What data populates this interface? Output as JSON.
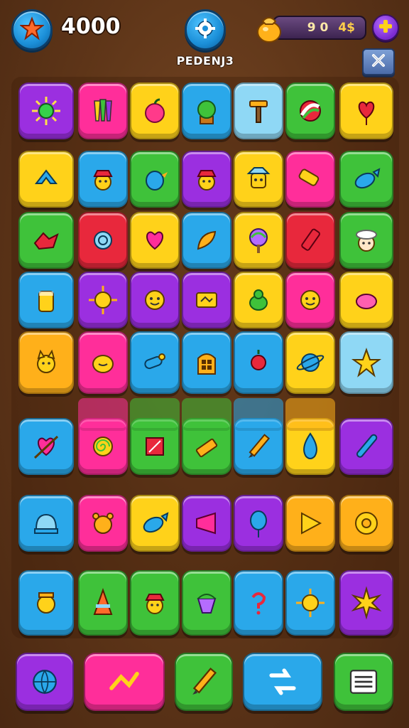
{
  "header": {
    "score": "4000",
    "level_label": "PEDENJ3",
    "currency_a": "9 0",
    "currency_b": "4$",
    "star_icon": "star-icon",
    "settings_icon": "gear-icon",
    "coin_icon": "coin-bag-icon",
    "plus_icon": "plus-icon",
    "close_icon": "close-icon"
  },
  "colors": {
    "purple": "#9b2fe0",
    "pink": "#ff2e9a",
    "yellow": "#ffd21a",
    "blue": "#2aa8ea",
    "lightblue": "#8fd8f5",
    "green": "#3fc23a",
    "red": "#e8283c",
    "orange": "#ffb01a"
  },
  "board": {
    "rows": [
      [
        {
          "color": "purple",
          "icon": "sun-gem-icon"
        },
        {
          "color": "pink",
          "icon": "crayons-icon"
        },
        {
          "color": "yellow",
          "icon": "apple-icon"
        },
        {
          "color": "blue",
          "icon": "potted-plant-icon"
        },
        {
          "color": "lightblue",
          "icon": "hammer-icon"
        },
        {
          "color": "green",
          "icon": "leaf-ball-icon"
        },
        {
          "color": "yellow",
          "icon": "heart-balloon-icon"
        }
      ],
      [
        {
          "color": "yellow",
          "icon": "ribbon-icon"
        },
        {
          "color": "blue",
          "icon": "hat-face-icon"
        },
        {
          "color": "green",
          "icon": "bird-icon"
        },
        {
          "color": "purple",
          "icon": "hat-face-icon"
        },
        {
          "color": "yellow",
          "icon": "robot-icon"
        },
        {
          "color": "pink",
          "icon": "roller-icon"
        },
        {
          "color": "green",
          "icon": "fish-icon"
        }
      ],
      [
        {
          "color": "green",
          "icon": "dragon-icon"
        },
        {
          "color": "red",
          "icon": "snail-icon"
        },
        {
          "color": "yellow",
          "icon": "heart-book-icon"
        },
        {
          "color": "blue",
          "icon": "feather-icon"
        },
        {
          "color": "yellow",
          "icon": "rainbow-tree-icon"
        },
        {
          "color": "red",
          "icon": "marker-icon"
        },
        {
          "color": "green",
          "icon": "cloud-face-icon"
        }
      ],
      [
        {
          "color": "blue",
          "icon": "jar-icon"
        },
        {
          "color": "purple",
          "icon": "sun-icon"
        },
        {
          "color": "purple",
          "icon": "smiley-icon"
        },
        {
          "color": "purple",
          "icon": "card-icon"
        },
        {
          "color": "yellow",
          "icon": "frog-icon"
        },
        {
          "color": "pink",
          "icon": "smiley-icon"
        },
        {
          "color": "yellow",
          "icon": "pig-icon"
        }
      ],
      [
        {
          "color": "orange",
          "icon": "cat-face-icon"
        },
        {
          "color": "pink",
          "icon": "blob-face-icon"
        },
        {
          "color": "blue",
          "icon": "cannon-icon"
        },
        {
          "color": "blue",
          "icon": "window-icon"
        },
        {
          "color": "blue",
          "icon": "flower-icon"
        },
        {
          "color": "yellow",
          "icon": "planet-icon"
        },
        {
          "color": "lightblue",
          "icon": "bird-star-icon"
        }
      ],
      [
        {
          "color": "blue",
          "icon": "heart-arrow-icon"
        },
        {
          "color": "pink",
          "icon": "spiral-icon"
        },
        {
          "color": "green",
          "icon": "cube-icon"
        },
        {
          "color": "green",
          "icon": "eraser-icon"
        },
        {
          "color": "blue",
          "icon": "pencil-icon"
        },
        {
          "color": "yellow",
          "icon": "drop-icon"
        },
        {
          "color": "purple",
          "icon": "bat-icon"
        }
      ],
      [
        {
          "color": "blue",
          "icon": "dome-icon"
        },
        {
          "color": "pink",
          "icon": "bear-icon"
        },
        {
          "color": "yellow",
          "icon": "fish-icon"
        },
        {
          "color": "purple",
          "icon": "horn-icon"
        },
        {
          "color": "purple",
          "icon": "balloon-icon"
        },
        {
          "color": "orange",
          "icon": "play-icon"
        },
        {
          "color": "orange",
          "icon": "gear-ring-icon"
        }
      ],
      [
        {
          "color": "blue",
          "icon": "lion-face-icon"
        },
        {
          "color": "green",
          "icon": "cone-icon"
        },
        {
          "color": "green",
          "icon": "hat-face-icon"
        },
        {
          "color": "green",
          "icon": "gem-icon"
        },
        {
          "color": "blue",
          "icon": "question-icon"
        },
        {
          "color": "blue",
          "icon": "sun-icon"
        },
        {
          "color": "purple",
          "icon": "burst-icon"
        }
      ]
    ]
  },
  "bottom_bar": [
    {
      "color": "purple",
      "icon": "globe-icon"
    },
    {
      "color": "pink",
      "icon": "shuffle-arrow-icon"
    },
    {
      "color": "green",
      "icon": "pencil-icon"
    },
    {
      "color": "blue",
      "icon": "swap-icon"
    },
    {
      "color": "green",
      "icon": "menu-icon"
    }
  ]
}
